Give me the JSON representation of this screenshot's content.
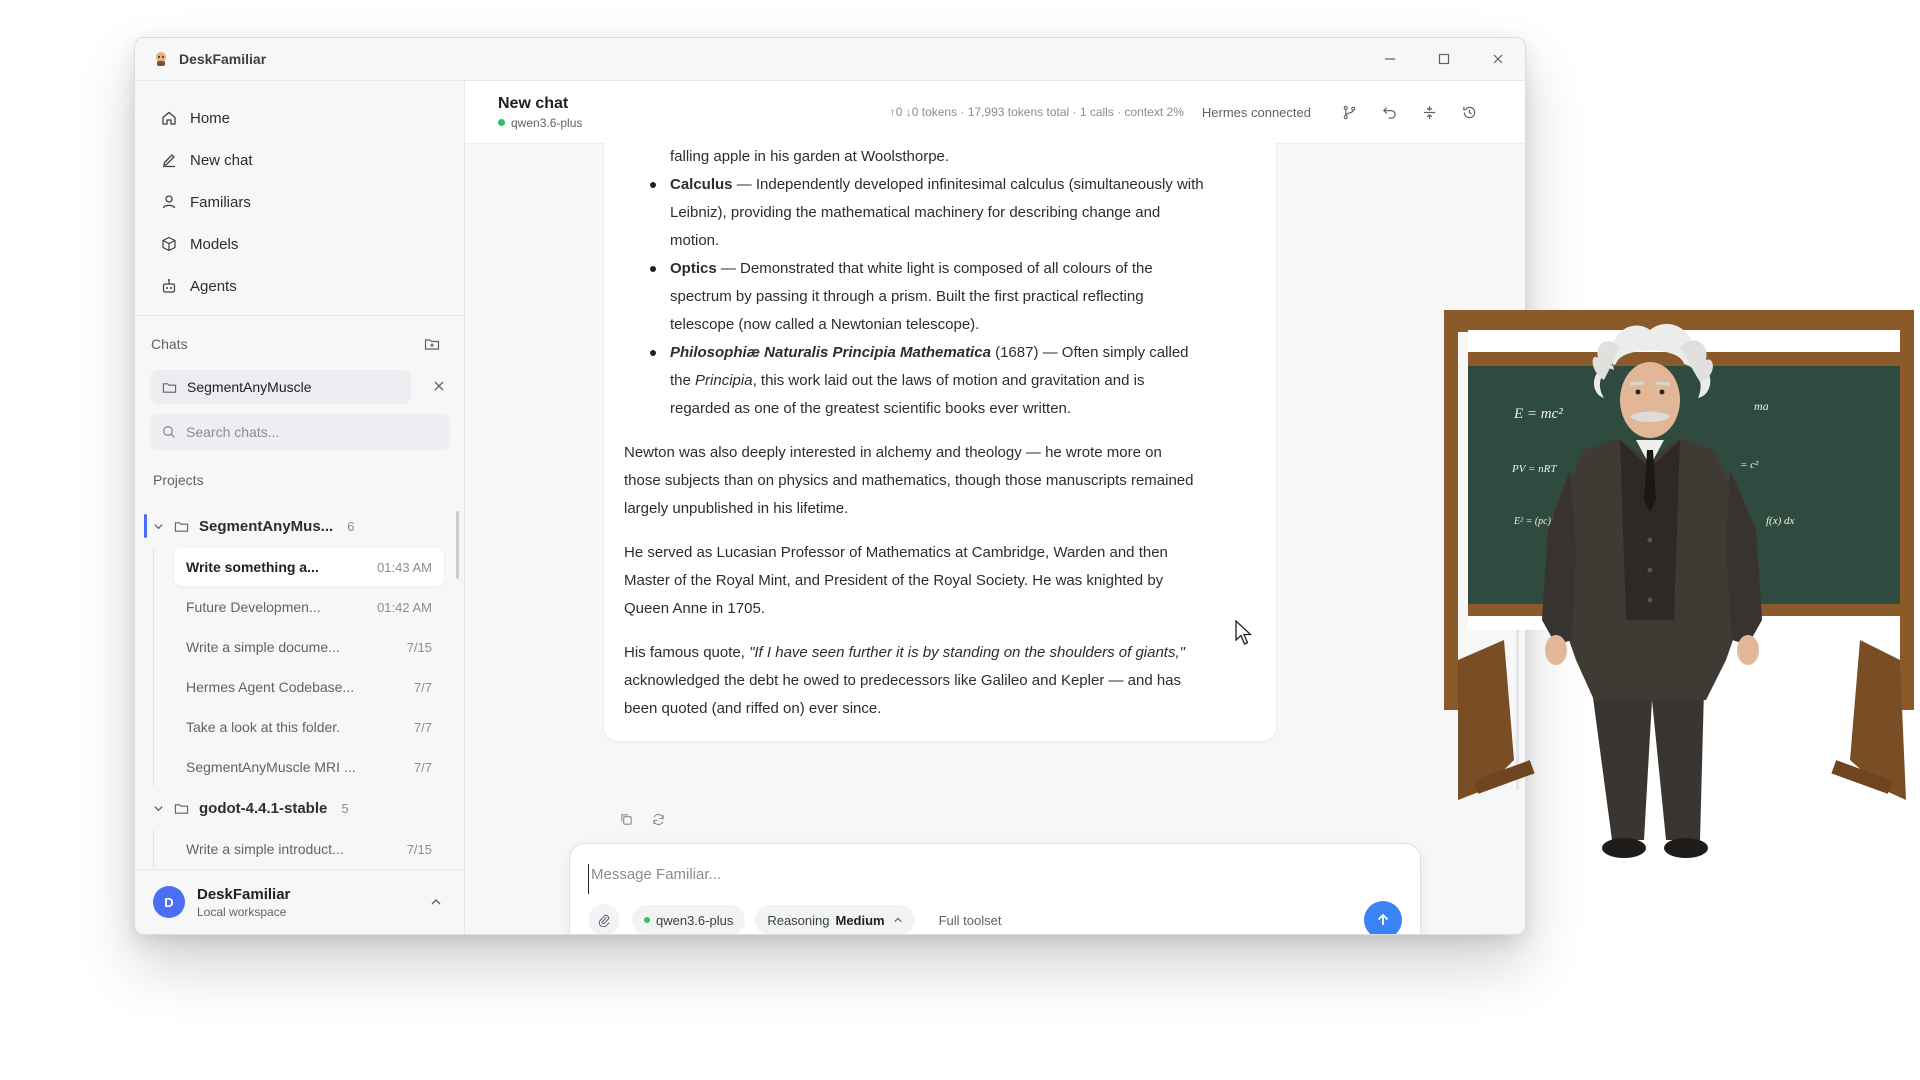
{
  "window": {
    "title": "DeskFamiliar"
  },
  "sidebar": {
    "nav": [
      {
        "label": "Home",
        "icon": "home-icon"
      },
      {
        "label": "New chat",
        "icon": "pencil-icon"
      },
      {
        "label": "Familiars",
        "icon": "person-icon"
      },
      {
        "label": "Models",
        "icon": "cube-icon"
      },
      {
        "label": "Agents",
        "icon": "robot-icon"
      }
    ],
    "chats_label": "Chats",
    "chat_filter": "SegmentAnyMuscle",
    "search_placeholder": "Search chats...",
    "projects_label": "Projects",
    "projects": [
      {
        "name": "SegmentAnyMus...",
        "count": "6",
        "threads": [
          {
            "title": "Write something a...",
            "time": "01:43 AM",
            "active": true
          },
          {
            "title": "Future Developmen...",
            "time": "01:42 AM"
          },
          {
            "title": "Write a simple docume...",
            "time": "7/15"
          },
          {
            "title": "Hermes Agent Codebase...",
            "time": "7/7"
          },
          {
            "title": "Take a look at this folder.",
            "time": "7/7"
          },
          {
            "title": "SegmentAnyMuscle MRI ...",
            "time": "7/7"
          }
        ]
      },
      {
        "name": "godot-4.4.1-stable",
        "count": "5",
        "threads": [
          {
            "title": "Write a simple introduct...",
            "time": "7/15"
          }
        ]
      }
    ],
    "user": {
      "initial": "D",
      "name": "DeskFamiliar",
      "subtitle": "Local workspace"
    }
  },
  "header": {
    "title": "New chat",
    "model": "qwen3.6-plus",
    "stats": "↑0 ↓0 tokens · 17,993 tokens total · 1 calls · context 2%",
    "connection": "Hermes connected"
  },
  "message": {
    "gravity_tail": "falling apple in his garden at Woolsthorpe.",
    "calculus_term": "Calculus",
    "calculus_l1": " — Independently developed infinitesimal calculus (simultaneously with",
    "calculus_l2": "Leibniz), providing the mathematical machinery for describing change and",
    "calculus_l3": "motion.",
    "optics_term": "Optics",
    "optics_l1": " — Demonstrated that white light is composed of all colours of the",
    "optics_l2": "spectrum by passing it through a prism. Built the first practical reflecting",
    "optics_l3": "telescope (now called a Newtonian telescope).",
    "principia_term": "Philosophiæ Naturalis Principia Mathematica",
    "principia_l1": " (1687) — Often simply called",
    "principia_l2a": "the ",
    "principia_l2b": "Principia",
    "principia_l2c": ", this work laid out the laws of motion and gravitation and is",
    "principia_l3": "regarded as one of the greatest scientific books ever written.",
    "para1_l1": "Newton was also deeply interested in alchemy and theology — he wrote more on",
    "para1_l2": "those subjects than on physics and mathematics, though those manuscripts remained",
    "para1_l3": "largely unpublished in his lifetime.",
    "para2_l1": "He served as Lucasian Professor of Mathematics at Cambridge, Warden and then",
    "para2_l2": "Master of the Royal Mint, and President of the Royal Society. He was knighted by",
    "para2_l3": "Queen Anne in 1705.",
    "para3_l1a": "His famous quote, ",
    "para3_quote": "\"If I have seen further it is by standing on the shoulders of giants,\"",
    "para3_l2": "acknowledged the debt he owed to predecessors like Galileo and Kepler — and has",
    "para3_l3": "been quoted (and riffed on) ever since."
  },
  "composer": {
    "placeholder": "Message Familiar...",
    "model_chip": "qwen3.6-plus",
    "reasoning_label": "Reasoning",
    "reasoning_value": "Medium",
    "toolset": "Full toolset"
  },
  "chalkboard": {
    "eq1": "E = mc²",
    "eq2": "PV = nRT",
    "eq3": "E² = (pc)² + (m",
    "eq4": "ma",
    "eq5": "= c²",
    "eq6": "f(x) dx"
  },
  "colors": {
    "accent": "#4c6ef5",
    "send": "#3b82f6",
    "online": "#22c55e",
    "chalkboard": "#2f4a3e",
    "frame": "#8a5a2b"
  }
}
